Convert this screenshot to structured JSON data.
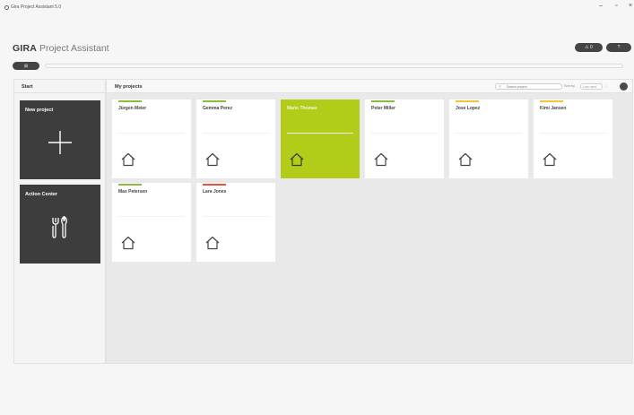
{
  "window": {
    "title": "Gira Project Assistant 5.0",
    "minimize": "–",
    "maximize": "▫",
    "close": "×"
  },
  "header": {
    "brand": "GIRA",
    "product": "Project Assistant",
    "notifications_label": "⚠ 0",
    "help_label": "?"
  },
  "nav": {
    "home_label": "⊞"
  },
  "start": {
    "title": "Start",
    "new_project_label": "New project",
    "action_center_label": "Action Center"
  },
  "projects": {
    "title": "My projects",
    "search_placeholder": "Search project",
    "sort_label": "Sort by",
    "sort_value": "Last used",
    "sort_direction": "↓",
    "items": [
      {
        "name": "Jürgen Meier",
        "color": "#8bbd3c",
        "selected": false
      },
      {
        "name": "Gemma Perez",
        "color": "#8bbd3c",
        "selected": false
      },
      {
        "name": "Marie Thomas",
        "color": "#b3cc1a",
        "selected": true
      },
      {
        "name": "Peter Miller",
        "color": "#8bbd3c",
        "selected": false
      },
      {
        "name": "Jose Lopez",
        "color": "#f3c13a",
        "selected": false
      },
      {
        "name": "Kimi Jansen",
        "color": "#f3c13a",
        "selected": false
      },
      {
        "name": "Max Petersen",
        "color": "#8bbd3c",
        "selected": false
      },
      {
        "name": "Lara Jones",
        "color": "#e2533f",
        "selected": false
      }
    ]
  },
  "colors": {
    "accent": "#b3cc1a",
    "dark_tile": "#3d3d3d",
    "panel_bg": "#e9e9e9"
  }
}
